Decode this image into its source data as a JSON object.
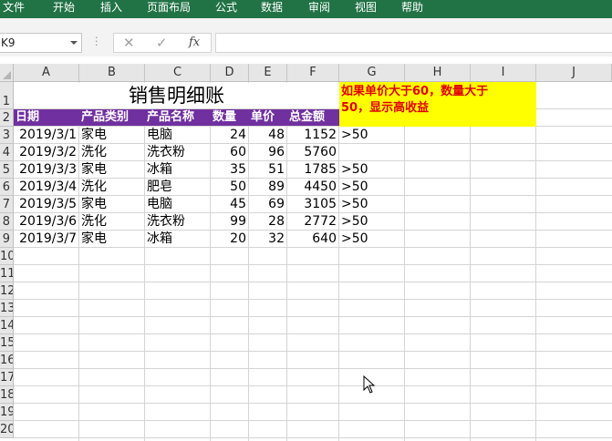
{
  "ribbon": {
    "tabs": [
      "文件",
      "开始",
      "插入",
      "页面布局",
      "公式",
      "数据",
      "审阅",
      "视图",
      "帮助"
    ]
  },
  "formula_bar": {
    "name_box": "K9",
    "cancel_icon": "✕",
    "enter_icon": "✓",
    "fx_label": "fx",
    "formula": ""
  },
  "columns": [
    "A",
    "B",
    "C",
    "D",
    "E",
    "F",
    "G",
    "H",
    "I",
    "J"
  ],
  "rows": [
    "1",
    "2",
    "3",
    "4",
    "5",
    "6",
    "7",
    "8",
    "9",
    "10",
    "11",
    "12",
    "13",
    "14",
    "15",
    "16",
    "17",
    "18",
    "19",
    "20"
  ],
  "sheet": {
    "title": "销售明细账",
    "headers": [
      "日期",
      "产品类别",
      "产品名称",
      "数量",
      "单价",
      "总金额"
    ],
    "data": [
      {
        "date": "2019/3/1",
        "category": "家电",
        "product": "电脑",
        "qty": "24",
        "price": "48",
        "total": "1152",
        "flag": ">50"
      },
      {
        "date": "2019/3/2",
        "category": "洗化",
        "product": "洗衣粉",
        "qty": "60",
        "price": "96",
        "total": "5760",
        "flag": ""
      },
      {
        "date": "2019/3/3",
        "category": "家电",
        "product": "冰箱",
        "qty": "35",
        "price": "51",
        "total": "1785",
        "flag": ">50"
      },
      {
        "date": "2019/3/4",
        "category": "洗化",
        "product": "肥皂",
        "qty": "50",
        "price": "89",
        "total": "4450",
        "flag": ">50"
      },
      {
        "date": "2019/3/5",
        "category": "家电",
        "product": "电脑",
        "qty": "45",
        "price": "69",
        "total": "3105",
        "flag": ">50"
      },
      {
        "date": "2019/3/6",
        "category": "洗化",
        "product": "洗衣粉",
        "qty": "99",
        "price": "28",
        "total": "2772",
        "flag": ">50"
      },
      {
        "date": "2019/3/7",
        "category": "家电",
        "product": "冰箱",
        "qty": "20",
        "price": "32",
        "total": "640",
        "flag": ">50"
      }
    ],
    "note_line1": "如果单价大于60，数量大于",
    "note_line2": "50，显示高收益"
  },
  "colors": {
    "ribbon": "#217346",
    "header_fill": "#7030a0",
    "note_fill": "#ffff00",
    "note_text": "#e00000"
  }
}
